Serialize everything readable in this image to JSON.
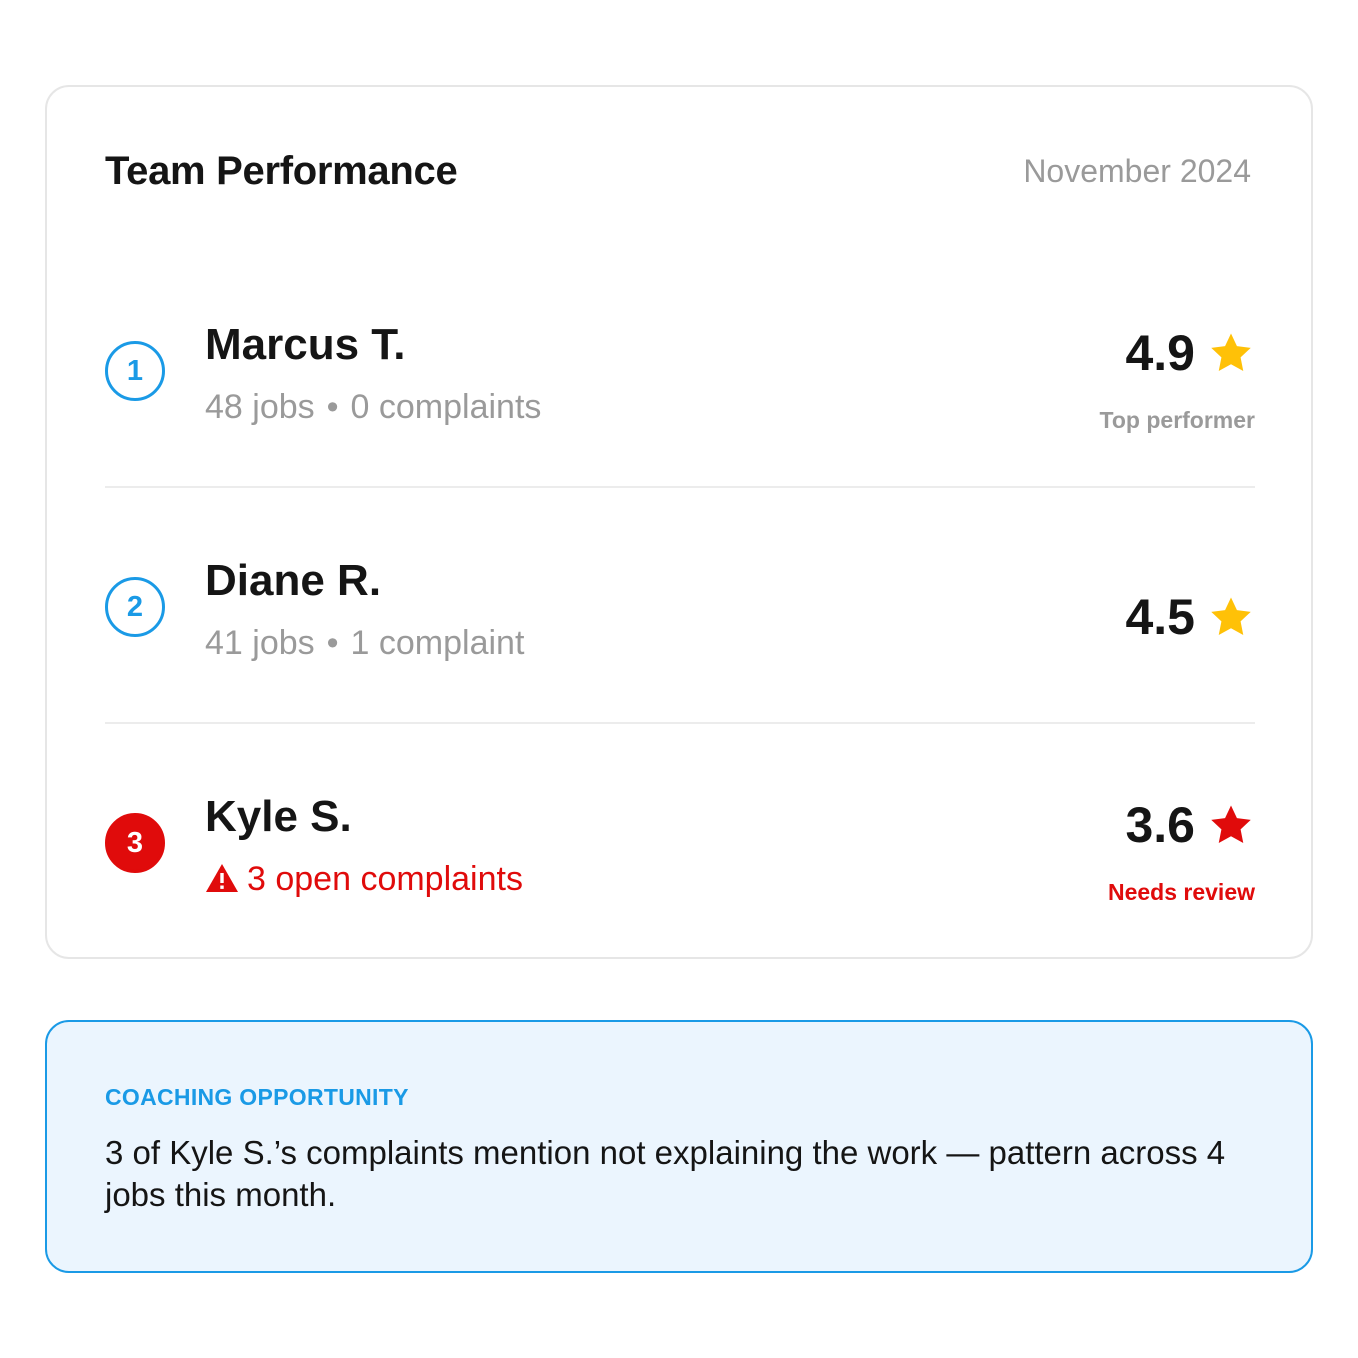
{
  "header": {
    "title": "Team Performance",
    "period": "November 2024"
  },
  "colors": {
    "accent": "#1a9ae6",
    "alert": "#e00b0b",
    "star_gold": "#ffc107",
    "muted": "#9a9a9a"
  },
  "team": [
    {
      "rank": "1",
      "name": "Marcus T.",
      "jobs": "48 jobs",
      "complaints": "0 complaints",
      "rating": "4.9",
      "star_icon": "star-icon",
      "status": "Top performer"
    },
    {
      "rank": "2",
      "name": "Diane R.",
      "jobs": "41 jobs",
      "complaints": "1 complaint",
      "rating": "4.5",
      "star_icon": "star-icon",
      "status": ""
    },
    {
      "rank": "3",
      "name": "Kyle S.",
      "alert_icon": "warning-icon",
      "alert_text": "3 open complaints",
      "rating": "3.6",
      "star_icon": "star-icon",
      "status": "Needs review"
    }
  ],
  "callout": {
    "label": "COACHING OPPORTUNITY",
    "text": "3 of Kyle S.’s complaints mention not explaining the work — pattern across 4 jobs this month."
  }
}
